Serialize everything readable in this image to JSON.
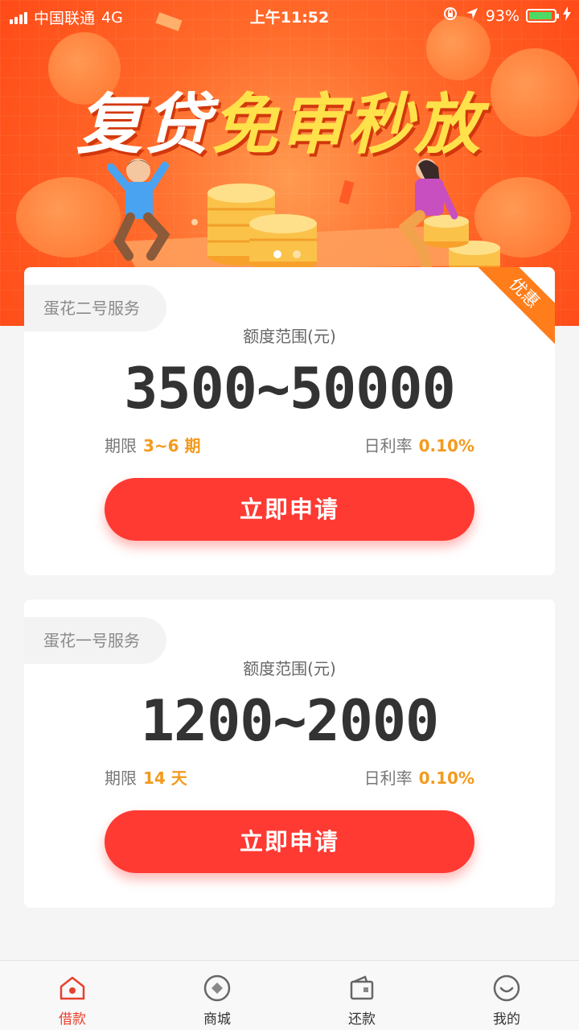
{
  "status_bar": {
    "carrier": "中国联通",
    "network": "4G",
    "time": "上午11:52",
    "battery": "93%",
    "battery_level": 0.93,
    "battery_color": "#4cd964"
  },
  "banner": {
    "headline_white": "复贷",
    "headline_yellow": "免审秒放",
    "slide_count": 2,
    "active_slide": 1
  },
  "products": [
    {
      "service_name": "蛋花二号服务",
      "badge": "优惠",
      "range_label": "额度范围(元)",
      "amount_range": "3500~50000",
      "term_label": "期限",
      "term_value": "3~6 期",
      "rate_label": "日利率",
      "rate_value": "0.10%",
      "apply_label": "立即申请"
    },
    {
      "service_name": "蛋花一号服务",
      "range_label": "额度范围(元)",
      "amount_range": "1200~2000",
      "term_label": "期限",
      "term_value": "14 天",
      "rate_label": "日利率",
      "rate_value": "0.10%",
      "apply_label": "立即申请"
    }
  ],
  "tab_bar": {
    "items": [
      {
        "label": "借款",
        "icon": "home-icon",
        "active": true
      },
      {
        "label": "商城",
        "icon": "mall-icon",
        "active": false
      },
      {
        "label": "还款",
        "icon": "wallet-icon",
        "active": false
      },
      {
        "label": "我的",
        "icon": "profile-icon",
        "active": false
      }
    ]
  },
  "colors": {
    "accent": "#fe3a33",
    "highlight": "#f39a1e",
    "badge": "#ff7d1a",
    "active_tab": "#e8402e"
  }
}
